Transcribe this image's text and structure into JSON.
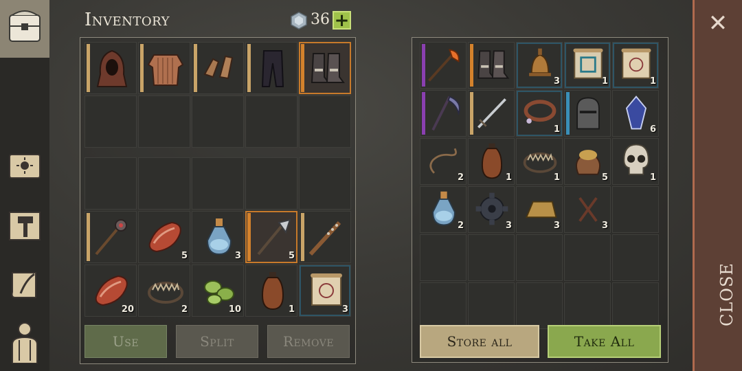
{
  "header": {
    "title": "Inventory",
    "gem_count": "36",
    "add_label": "+"
  },
  "inventory": {
    "equipment_row": [
      {
        "icon": "hood-icon",
        "rarity": "#c9a468",
        "qty": ""
      },
      {
        "icon": "chainmail-icon",
        "rarity": "#c9a468",
        "qty": ""
      },
      {
        "icon": "gloves-icon",
        "rarity": "#c9a468",
        "qty": ""
      },
      {
        "icon": "pants-icon",
        "rarity": "#c9a468",
        "qty": ""
      },
      {
        "icon": "boots-icon",
        "rarity": "#d4822c",
        "qty": "",
        "selected": true
      }
    ],
    "items": [
      {
        "icon": "spiked-mace-icon",
        "rarity": "#c9a468",
        "qty": ""
      },
      {
        "icon": "raw-meat-icon",
        "rarity": "",
        "qty": "5"
      },
      {
        "icon": "potion-bottle-icon",
        "rarity": "",
        "qty": "3"
      },
      {
        "icon": "halberd-icon",
        "rarity": "#d4822c",
        "qty": "5",
        "selected": true
      },
      {
        "icon": "spiked-club-icon",
        "rarity": "#c9a468",
        "qty": ""
      },
      {
        "icon": "raw-meat-icon",
        "rarity": "",
        "qty": "20"
      },
      {
        "icon": "bear-trap-icon",
        "rarity": "",
        "qty": "2"
      },
      {
        "icon": "green-beans-icon",
        "rarity": "",
        "qty": "10"
      },
      {
        "icon": "leather-flask-icon",
        "rarity": "",
        "qty": "1"
      },
      {
        "icon": "scroll-icon",
        "rarity": "",
        "qty": "3",
        "blue": true
      }
    ]
  },
  "container_items": [
    {
      "icon": "fire-axe-icon",
      "rarity": "#8a3fb0",
      "qty": ""
    },
    {
      "icon": "boots-icon",
      "rarity": "#d4822c",
      "qty": ""
    },
    {
      "icon": "bell-icon",
      "rarity": "",
      "qty": "3",
      "blue": true
    },
    {
      "icon": "blueprint-scroll-icon",
      "rarity": "",
      "qty": "1",
      "blue": true
    },
    {
      "icon": "scroll-icon",
      "rarity": "",
      "qty": "1",
      "blue": true
    },
    {
      "icon": "scythe-icon",
      "rarity": "#8a3fb0",
      "qty": ""
    },
    {
      "icon": "sword-icon",
      "rarity": "#c9a468",
      "qty": ""
    },
    {
      "icon": "collar-icon",
      "rarity": "",
      "qty": "1",
      "blue": true
    },
    {
      "icon": "helmet-icon",
      "rarity": "#3a8fb8",
      "qty": ""
    },
    {
      "icon": "crystal-icon",
      "rarity": "",
      "qty": "6"
    },
    {
      "icon": "rope-icon",
      "rarity": "",
      "qty": "2"
    },
    {
      "icon": "leather-flask-icon",
      "rarity": "",
      "qty": "1"
    },
    {
      "icon": "bear-trap-icon",
      "rarity": "",
      "qty": "1"
    },
    {
      "icon": "grain-sack-icon",
      "rarity": "",
      "qty": "5"
    },
    {
      "icon": "skull-icon",
      "rarity": "",
      "qty": "1"
    },
    {
      "icon": "potion-bottle-icon",
      "rarity": "",
      "qty": "2"
    },
    {
      "icon": "gear-icon",
      "rarity": "",
      "qty": "3"
    },
    {
      "icon": "gold-ingot-icon",
      "rarity": "",
      "qty": "3"
    },
    {
      "icon": "nails-icon",
      "rarity": "",
      "qty": "3"
    }
  ],
  "buttons": {
    "use": "Use",
    "split": "Split",
    "remove": "Remove",
    "store_all": "Store all",
    "take_all": "Take All",
    "close": "CLOSE",
    "close_x": "✕"
  }
}
